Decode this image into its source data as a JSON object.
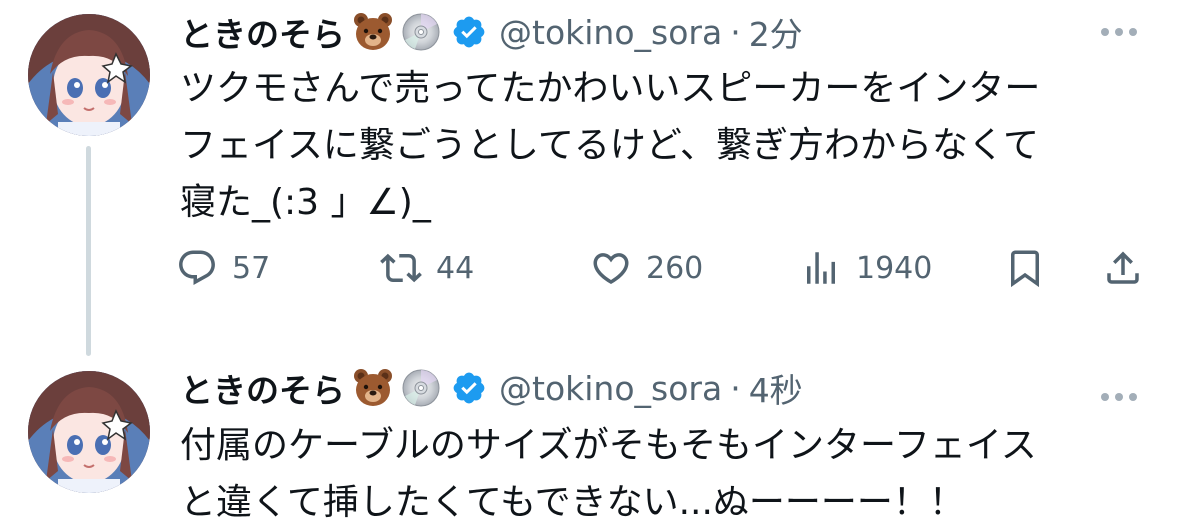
{
  "tweets": [
    {
      "display_name": "ときのそら",
      "handle": "@tokino_sora",
      "separator": "·",
      "time": "2分",
      "text": "ツクモさんで売ってたかわいいスピーカーをインター\nフェイスに繋ごうとしてるけど、繋ぎ方わからなくて\n寝た_(:3 」∠)_",
      "actions": {
        "reply_count": "57",
        "retweet_count": "44",
        "like_count": "260",
        "views_count": "1940"
      }
    },
    {
      "display_name": "ときのそら",
      "handle": "@tokino_sora",
      "separator": "·",
      "time": "4秒",
      "text": "付属のケーブルのサイズがそもそもインターフェイス\nと違くて挿したくてもできない...ぬーーーー！！"
    }
  ],
  "icons": {
    "name_emoji_1": "bear-face-icon",
    "name_emoji_2": "optical-disc-icon",
    "verified": "verified-badge-icon",
    "more": "more-icon",
    "reply": "reply-icon",
    "retweet": "retweet-icon",
    "like": "heart-icon",
    "views": "views-icon",
    "bookmark": "bookmark-icon",
    "share": "share-icon"
  },
  "colors": {
    "text": "#0f1419",
    "secondary": "#536471",
    "verified": "#1d9bf0",
    "thread_line": "#cfd9de"
  }
}
